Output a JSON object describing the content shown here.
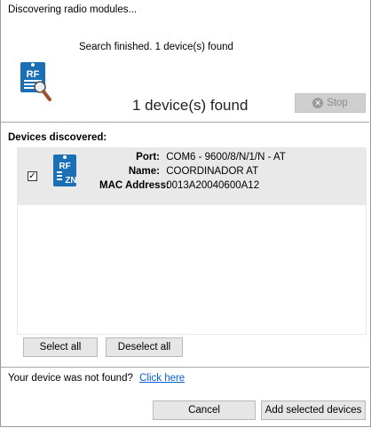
{
  "window": {
    "title": "Discovering radio modules..."
  },
  "status": {
    "message": "Search finished. 1 device(s) found"
  },
  "progress": {
    "summary": "1 device(s) found",
    "stop_label": "Stop",
    "stop_enabled": false
  },
  "devices": {
    "section_label": "Devices discovered:",
    "items": [
      {
        "checked": true,
        "icon": "xbee-rf-zn-icon",
        "port_label": "Port:",
        "port": "COM6 - 9600/8/N/1/N - AT",
        "name_label": "Name:",
        "name": "COORDINADOR AT",
        "mac_label": "MAC Address:",
        "mac": "0013A20040600A12"
      }
    ]
  },
  "selection": {
    "select_all": "Select all",
    "deselect_all": "Deselect all"
  },
  "footer": {
    "not_found_text": "Your device was not found?",
    "link_text": "Click here",
    "cancel_label": "Cancel",
    "add_label": "Add selected devices"
  },
  "colors": {
    "accent_blue": "#1b6fb5",
    "row_bg": "#e9e9e9",
    "link": "#0a5fd8"
  }
}
